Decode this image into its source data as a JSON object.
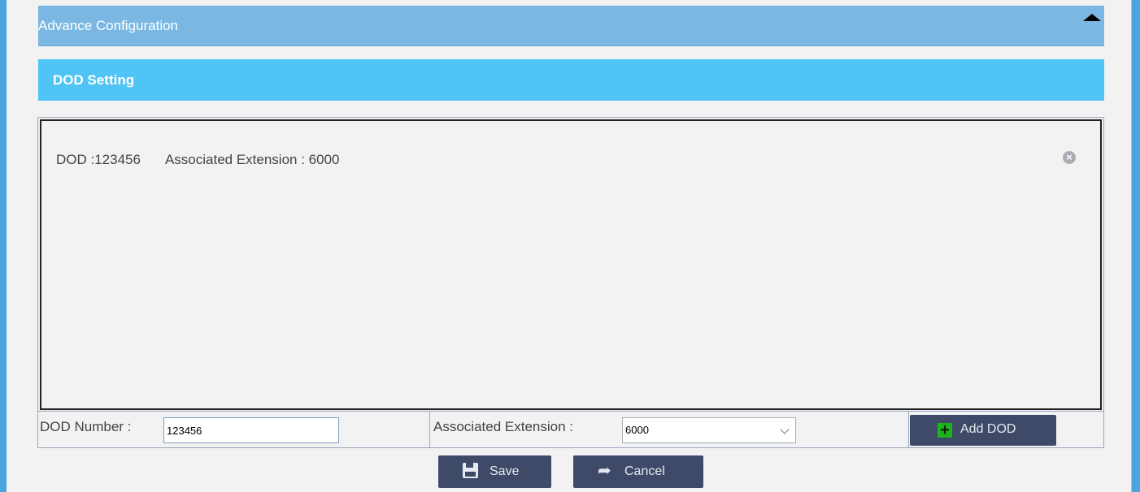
{
  "advance_config": {
    "title": "Advance Configuration",
    "toggle_icon": "triangle-up-icon"
  },
  "dod_setting": {
    "title": "DOD Setting"
  },
  "dod_list": [
    {
      "dod_text": "DOD :123456",
      "assoc_text": "Associated Extension : 6000",
      "remove_icon": "close-circle-icon"
    }
  ],
  "form": {
    "dod_number_label": "DOD Number :",
    "dod_number_value": "123456",
    "assoc_ext_label": "Associated Extension :",
    "assoc_ext_value": "6000",
    "add_button": "Add DOD",
    "add_icon": "plus-icon"
  },
  "actions": {
    "save": "Save",
    "save_icon": "floppy-icon",
    "cancel": "Cancel",
    "cancel_icon": "share-arrow-icon"
  },
  "colors": {
    "advance_bar": "#7ab8e3",
    "dod_header": "#4fc4f5",
    "button": "#3e4a68",
    "add_icon": "#1bb41b",
    "frame": "#4ba3e0"
  }
}
